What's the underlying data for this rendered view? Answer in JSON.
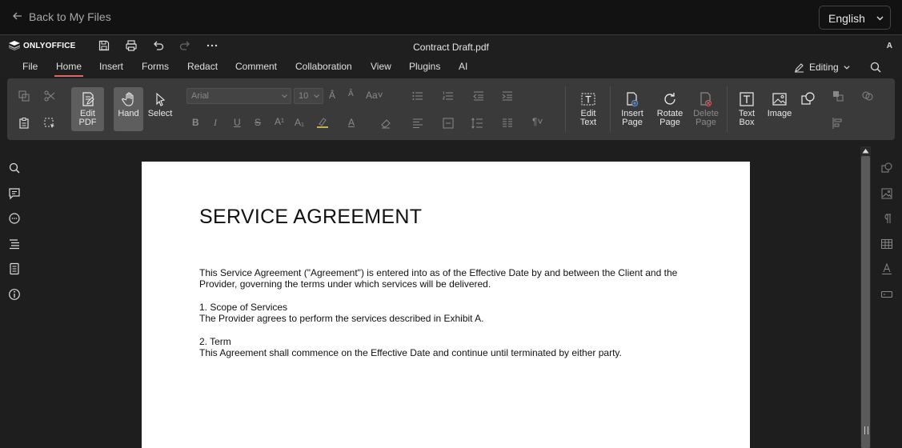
{
  "site": {
    "back_label": "Back to My Files",
    "language": "English"
  },
  "app": {
    "logo_text": "ONLYOFFICE",
    "doc_title": "Contract Draft.pdf",
    "avatar": "A"
  },
  "menu": {
    "tabs": [
      "File",
      "Home",
      "Insert",
      "Forms",
      "Redact",
      "Comment",
      "Collaboration",
      "View",
      "Plugins",
      "AI"
    ],
    "active": "Home",
    "mode_label": "Editing"
  },
  "toolbar": {
    "edit_pdf_line1": "Edit",
    "edit_pdf_line2": "PDF",
    "hand": "Hand",
    "select": "Select",
    "font_name": "Arial",
    "font_size": "10",
    "edit_text_line1": "Edit",
    "edit_text_line2": "Text",
    "insert_page_line1": "Insert",
    "insert_page_line2": "Page",
    "rotate_page_line1": "Rotate",
    "rotate_page_line2": "Page",
    "delete_page_line1": "Delete",
    "delete_page_line2": "Page",
    "text_box_line1": "Text",
    "text_box_line2": "Box",
    "image": "Image"
  },
  "document": {
    "heading": "SERVICE AGREEMENT",
    "intro_line1": "This Service Agreement (\"Agreement\") is entered into as of the Effective Date by and between the Client and the",
    "intro_line2": "Provider, governing the terms under which services will be delivered.",
    "s1_title": "1. Scope of Services",
    "s1_body": "The Provider agrees to perform the services described in Exhibit A.",
    "s2_title": "2. Term",
    "s2_body": "This Agreement shall commence on the Effective Date and continue until terminated by either party."
  },
  "colors": {
    "active_tab_underline": "#dd6666",
    "toolbar_bg": "#3a3a3a",
    "page_bg": "#ffffff",
    "app_bg": "#1e1e1e"
  }
}
